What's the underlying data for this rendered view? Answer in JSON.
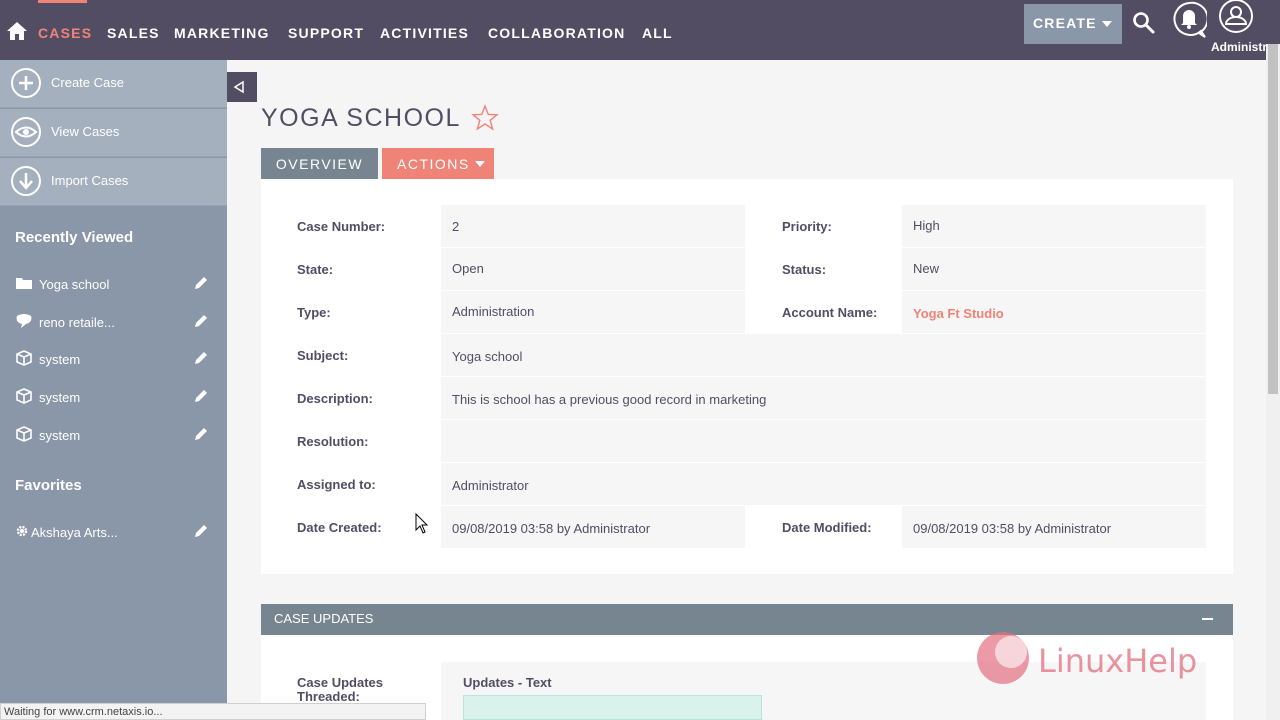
{
  "nav": {
    "items": [
      "CASES",
      "SALES",
      "MARKETING",
      "SUPPORT",
      "ACTIVITIES",
      "COLLABORATION",
      "ALL"
    ],
    "create_label": "CREATE",
    "user_label": "Administr"
  },
  "sidebar": {
    "actions": [
      "Create Case",
      "View Cases",
      "Import Cases"
    ],
    "recent_heading": "Recently Viewed",
    "recent_items": [
      "Yoga school",
      "reno retaile...",
      "system",
      "system",
      "system"
    ],
    "favorites_heading": "Favorites",
    "favorite_items": [
      "Akshaya Arts..."
    ]
  },
  "record": {
    "title": "YOGA SCHOOL",
    "tabs": {
      "overview": "OVERVIEW",
      "actions": "ACTIONS"
    },
    "fields": {
      "case_number_label": "Case Number:",
      "case_number": "2",
      "priority_label": "Priority:",
      "priority": "High",
      "state_label": "State:",
      "state": "Open",
      "status_label": "Status:",
      "status": "New",
      "type_label": "Type:",
      "type": "Administration",
      "account_label": "Account Name:",
      "account": "Yoga Ft Studio",
      "subject_label": "Subject:",
      "subject": "Yoga school",
      "description_label": "Description:",
      "description": "This is school has a previous good record in marketing",
      "resolution_label": "Resolution:",
      "resolution": "",
      "assigned_label": "Assigned to:",
      "assigned": "Administrator",
      "created_label": "Date Created:",
      "created": "09/08/2019 03:58 by Administrator",
      "modified_label": "Date Modified:",
      "modified": "09/08/2019 03:58 by Administrator"
    }
  },
  "updates": {
    "heading": "CASE UPDATES",
    "threaded_label": "Case Updates Threaded:",
    "text_label": "Updates - Text"
  },
  "watermark": "LinuxHelp",
  "status_bar": "Waiting for www.crm.netaxis.io...",
  "colors": {
    "nav_bg": "#534d64",
    "accent": "#f08377",
    "sidebar_bg": "#8a97a9",
    "tab_bg": "#778591"
  }
}
